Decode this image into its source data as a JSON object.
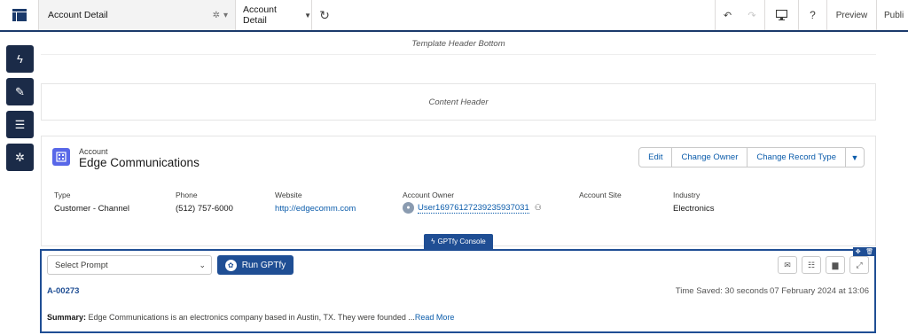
{
  "toolbar": {
    "page_name": "Account Detail",
    "view_name": "Account Detail",
    "preview_label": "Preview",
    "publish_label": "Publi",
    "help_label": "?"
  },
  "canvas": {
    "template_header": "Template Header Bottom",
    "content_header": "Content Header"
  },
  "record": {
    "object_label": "Account",
    "name": "Edge Communications",
    "actions": [
      "Edit",
      "Change Owner",
      "Change Record Type"
    ],
    "fields": {
      "type": {
        "label": "Type",
        "value": "Customer - Channel"
      },
      "phone": {
        "label": "Phone",
        "value": "(512) 757-6000"
      },
      "website": {
        "label": "Website",
        "value": "http://edgecomm.com"
      },
      "owner": {
        "label": "Account Owner",
        "value": "User16976127239235937031"
      },
      "site": {
        "label": "Account Site",
        "value": ""
      },
      "industry": {
        "label": "Industry",
        "value": "Electronics"
      }
    }
  },
  "gptfy": {
    "tab_label": "GPTfy Console",
    "prompt_placeholder": "Select Prompt",
    "run_label": "Run GPTfy",
    "record_id": "A-00273",
    "time_saved": "Time Saved: 30 seconds",
    "timestamp": "07 February 2024 at 13:06",
    "summary_label": "Summary:",
    "summary_text": "Edge Communications is an electronics company based in Austin, TX. They were founded ...",
    "read_more": "Read More"
  },
  "colors": {
    "nav_dark": "#1b2b48",
    "brand_blue": "#1f4e94",
    "link_blue": "#0b5cab",
    "account_icon": "#5867e8"
  }
}
